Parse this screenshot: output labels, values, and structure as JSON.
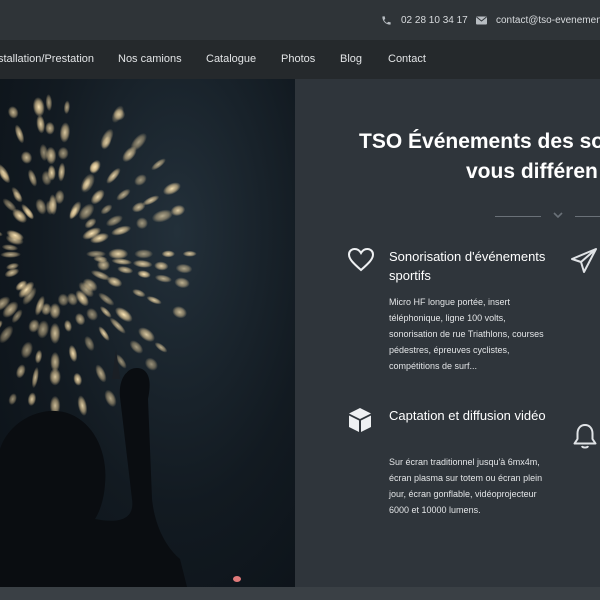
{
  "topbar": {
    "phone": "02 28 10 34 17",
    "email": "contact@tso-evenements"
  },
  "nav": {
    "items": [
      "stallation/Prestation",
      "Nos camions",
      "Catalogue",
      "Photos",
      "Blog",
      "Contact"
    ]
  },
  "hero": {
    "image": "fireworks-night-photo"
  },
  "panel": {
    "headline_line1": "TSO Événements  des so",
    "headline_line2": "vous différen"
  },
  "features": [
    {
      "icon": "heart-icon",
      "title": "Sonorisation d'événements sportifs",
      "desc": "Micro HF longue portée, insert téléphonique, ligne 100 volts, sonorisation de rue Triathlons, courses pédestres, épreuves cyclistes, compétitions de surf..."
    },
    {
      "icon": "cube-icon",
      "title": "Captation et diffusion vidéo",
      "desc": "Sur écran traditionnel jusqu'à 6mx4m, écran plasma sur totem ou écran plein jour, écran gonflable, vidéoprojecteur 6000 et 10000 lumens."
    }
  ],
  "side_icons": [
    "paper-plane-icon",
    "bell-icon"
  ],
  "colors": {
    "topbar": "#2f3438",
    "nav": "#25292c",
    "panel": "#2f353b"
  }
}
